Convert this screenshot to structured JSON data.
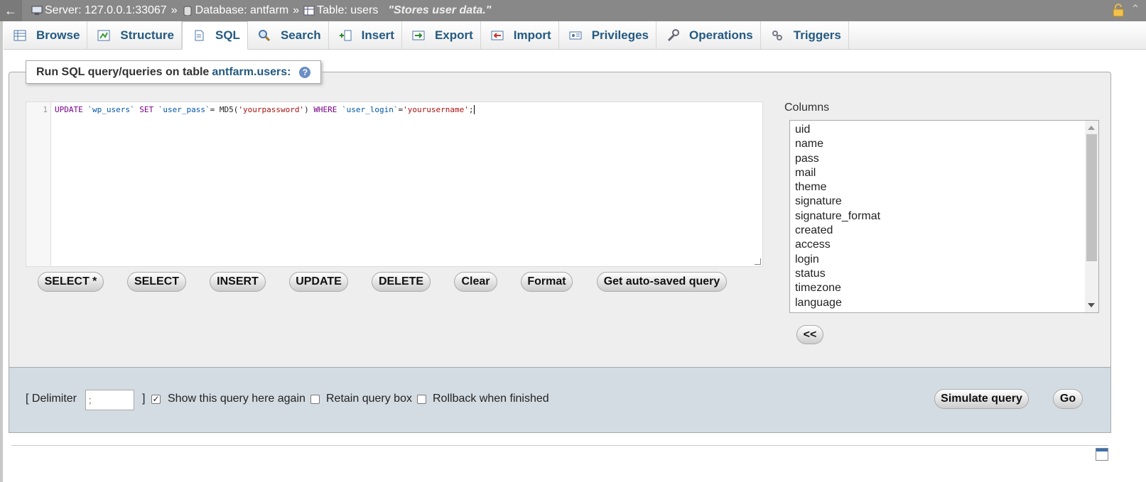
{
  "breadcrumb": {
    "back": "←",
    "server": "Server: 127.0.0.1:33067",
    "sep1": "»",
    "database": "Database: antfarm",
    "sep2": "»",
    "table": "Table: users",
    "comment": "\"Stores user data.\""
  },
  "tabs": [
    {
      "label": "Browse",
      "icon": "browse-icon"
    },
    {
      "label": "Structure",
      "icon": "structure-icon"
    },
    {
      "label": "SQL",
      "icon": "sql-icon",
      "active": true
    },
    {
      "label": "Search",
      "icon": "search-icon"
    },
    {
      "label": "Insert",
      "icon": "insert-icon"
    },
    {
      "label": "Export",
      "icon": "export-icon"
    },
    {
      "label": "Import",
      "icon": "import-icon"
    },
    {
      "label": "Privileges",
      "icon": "privileges-icon"
    },
    {
      "label": "Operations",
      "icon": "operations-icon"
    },
    {
      "label": "Triggers",
      "icon": "triggers-icon"
    }
  ],
  "legend": {
    "prefix": "Run SQL query/queries on table",
    "table": "antfarm.users:"
  },
  "editor": {
    "line_number": "1",
    "tokens": {
      "t1": "UPDATE",
      "t2": "`wp_users`",
      "t3": "SET",
      "t4": "`user_pass`",
      "t5": "= MD5(",
      "t6": "'yourpassword'",
      "t7": ")",
      "t8": "WHERE",
      "t9": "`user_login`",
      "t10": "=",
      "t11": "'yourusername'",
      "t12": ";"
    }
  },
  "buttons": {
    "select_star": "SELECT *",
    "select": "SELECT",
    "insert": "INSERT",
    "update": "UPDATE",
    "delete": "DELETE",
    "clear": "Clear",
    "format": "Format",
    "auto_saved": "Get auto-saved query",
    "insert_column": "<<",
    "simulate": "Simulate query",
    "go": "Go"
  },
  "columns": {
    "label": "Columns",
    "items": [
      "uid",
      "name",
      "pass",
      "mail",
      "theme",
      "signature",
      "signature_format",
      "created",
      "access",
      "login",
      "status",
      "timezone",
      "language"
    ]
  },
  "options": {
    "delimiter_open": "[ Delimiter",
    "delimiter_value": ";",
    "delimiter_close": "]",
    "show_query_again": "Show this query here again",
    "show_query_again_checked": true,
    "retain_query_box": "Retain query box",
    "retain_query_box_checked": false,
    "rollback": "Rollback when finished",
    "rollback_checked": false
  },
  "colors": {
    "topbar": "#888888",
    "link": "#235a81",
    "bottom_panel": "#d3dce3",
    "fieldset": "#eeeeee"
  }
}
